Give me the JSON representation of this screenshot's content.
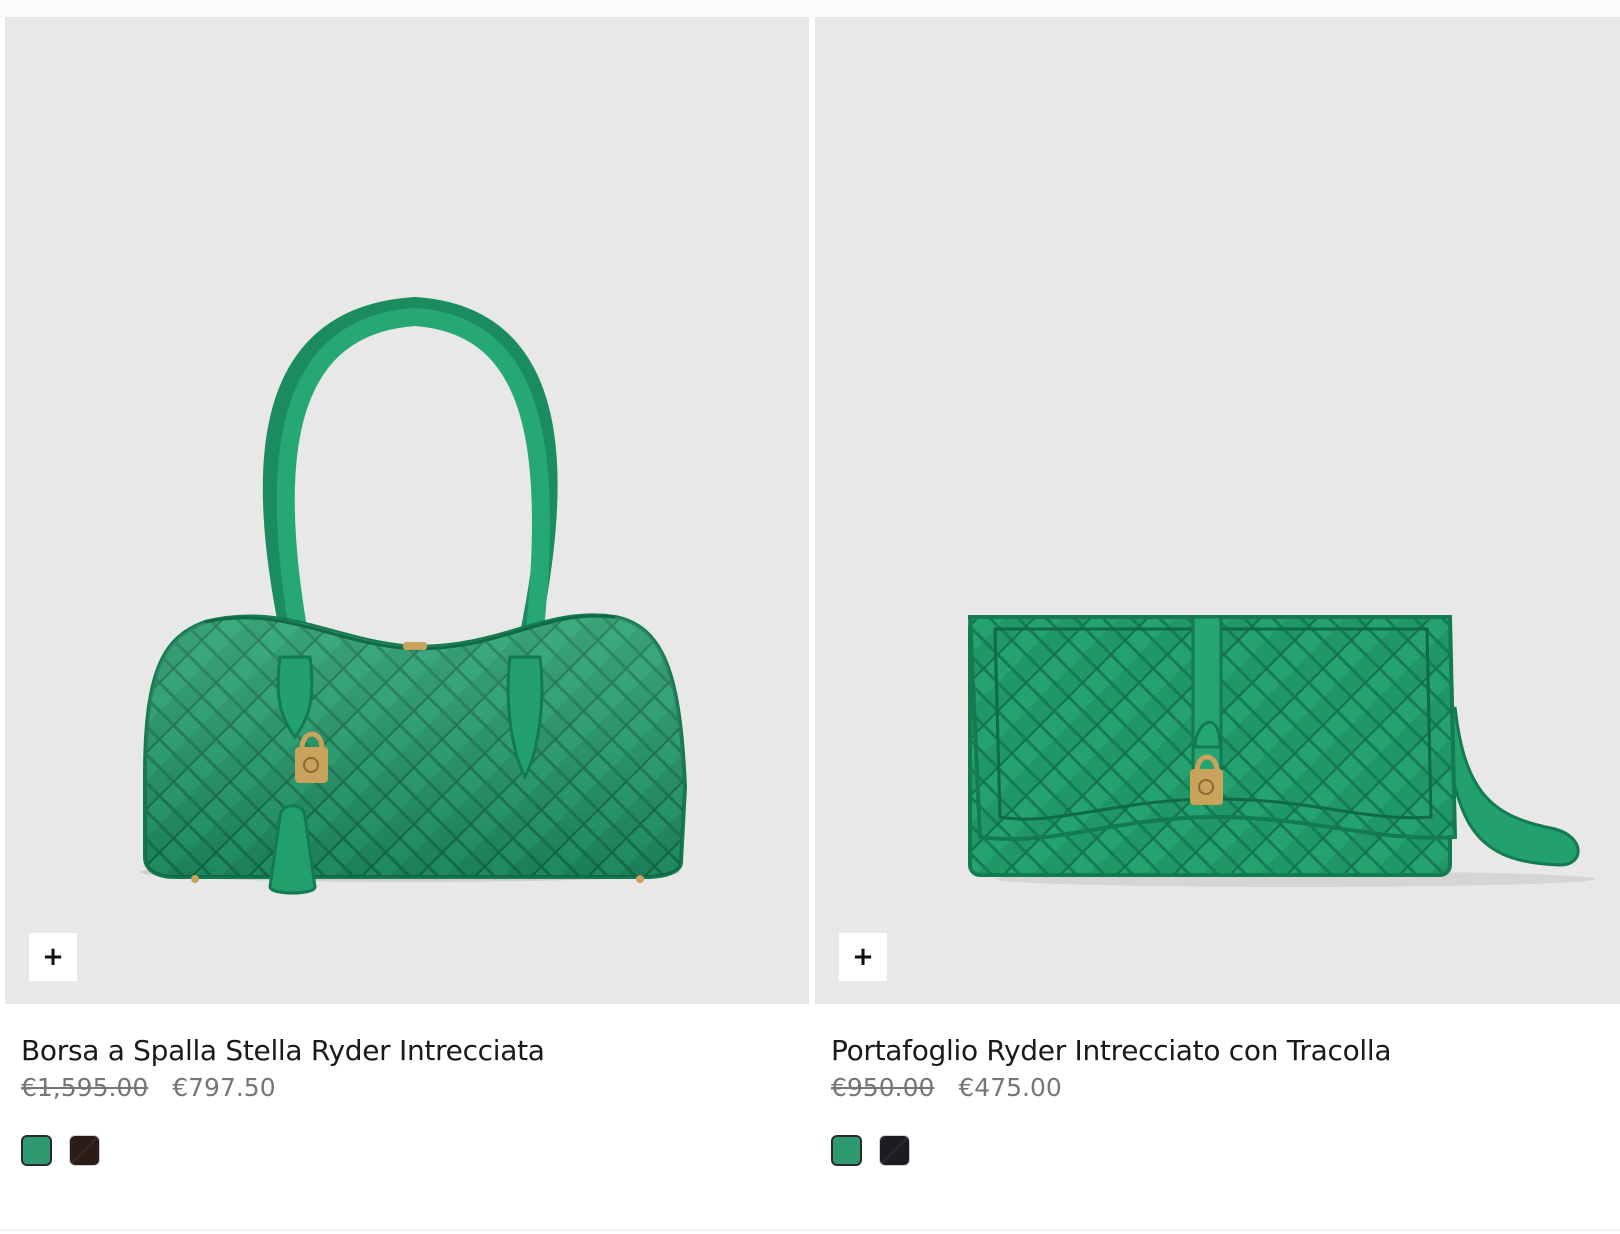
{
  "products": [
    {
      "title": "Borsa a Spalla Stella Ryder Intrecciata",
      "price_original": "€1,595.00",
      "price_sale": "€797.50",
      "quick_add_icon": "plus-icon",
      "swatches": [
        {
          "color": "#2f9a72",
          "selected": true
        },
        {
          "color": "#2a1c18",
          "selected": false
        }
      ]
    },
    {
      "title": "Portafoglio Ryder Intrecciato con Tracolla",
      "price_original": "€950.00",
      "price_sale": "€475.00",
      "quick_add_icon": "plus-icon",
      "swatches": [
        {
          "color": "#2f9a72",
          "selected": true
        },
        {
          "color": "#1b1d22",
          "selected": false
        }
      ]
    }
  ],
  "colors": {
    "media_background": "#e8e8e8",
    "bag_green": "#23a06f",
    "bag_green_dark": "#15805a",
    "hardware_gold": "#c9a25c"
  }
}
